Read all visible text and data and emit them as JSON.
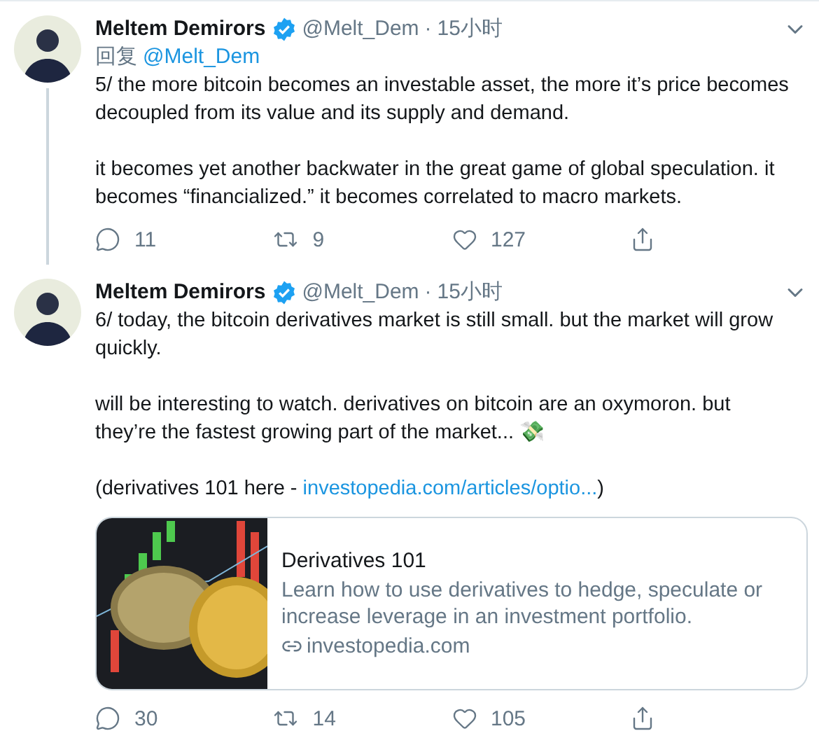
{
  "tweets": [
    {
      "author": "Meltem Demirors",
      "verified": true,
      "handle": "@Melt_Dem",
      "separator": "·",
      "time": "15小时",
      "thread_continues": true,
      "reply_to": {
        "label": "回复",
        "handle": "@Melt_Dem"
      },
      "paragraphs": [
        [
          {
            "kind": "text",
            "text": "5/ the more bitcoin becomes an investable asset, the more it’s price becomes decoupled from its value and its supply and demand."
          }
        ],
        [
          {
            "kind": "text",
            "text": "it becomes yet another backwater in the great game of global speculation. it becomes “financialized.” it becomes correlated to macro markets."
          }
        ]
      ],
      "actions": [
        {
          "kind": "reply",
          "count": "11"
        },
        {
          "kind": "retweet",
          "count": "9"
        },
        {
          "kind": "like",
          "count": "127"
        },
        {
          "kind": "share"
        }
      ]
    },
    {
      "author": "Meltem Demirors",
      "verified": true,
      "handle": "@Melt_Dem",
      "separator": "·",
      "time": "15小时",
      "thread_continues": false,
      "paragraphs": [
        [
          {
            "kind": "text",
            "text": "6/ today, the bitcoin derivatives market is still small. but the market will grow quickly."
          }
        ],
        [
          {
            "kind": "text",
            "text": "will be interesting to watch. derivatives on bitcoin are an oxymoron. but they’re the fastest growing part of the market... 💸"
          }
        ],
        [
          {
            "kind": "text",
            "text": "(derivatives 101 here - "
          },
          {
            "kind": "link",
            "text": "investopedia.com/articles/optio..."
          },
          {
            "kind": "text",
            "text": ")"
          }
        ]
      ],
      "card": {
        "title": "Derivatives 101",
        "description": "Learn how to use derivatives to hedge, speculate or increase leverage in an investment portfolio.",
        "domain": "investopedia.com"
      },
      "actions": [
        {
          "kind": "reply",
          "count": "30"
        },
        {
          "kind": "retweet",
          "count": "14"
        },
        {
          "kind": "like",
          "count": "105"
        },
        {
          "kind": "share"
        }
      ]
    }
  ]
}
